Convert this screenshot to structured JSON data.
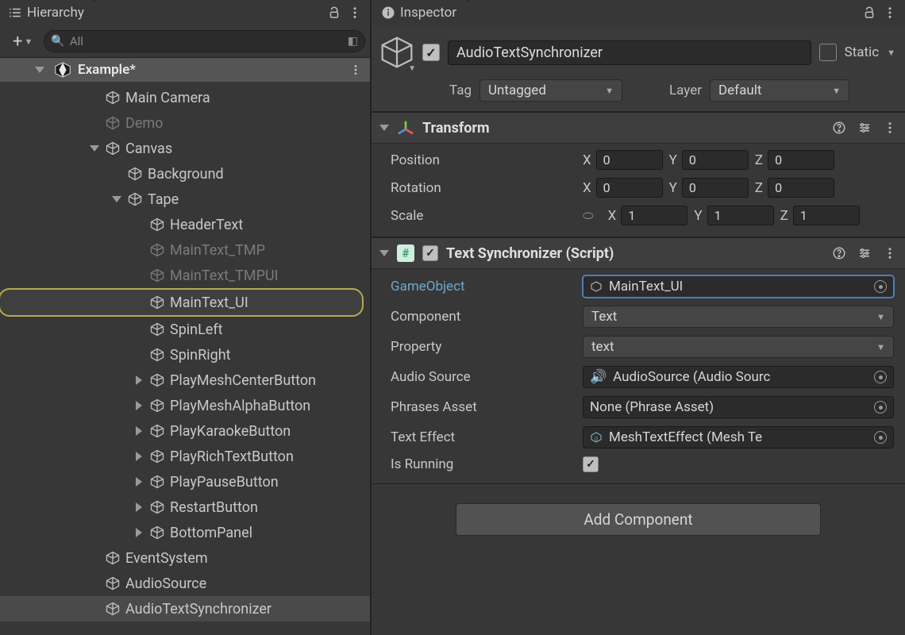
{
  "hierarchy": {
    "title": "Hierarchy",
    "search_placeholder": "All",
    "scene": "Example*",
    "items": [
      {
        "name": "Main Camera",
        "depth": 1,
        "dim": false
      },
      {
        "name": "Demo",
        "depth": 1,
        "dim": true
      },
      {
        "name": "Canvas",
        "depth": 1,
        "dim": false,
        "fold": "down"
      },
      {
        "name": "Background",
        "depth": 2,
        "dim": false
      },
      {
        "name": "Tape",
        "depth": 2,
        "dim": false,
        "fold": "down"
      },
      {
        "name": "HeaderText",
        "depth": 3,
        "dim": false
      },
      {
        "name": "MainText_TMP",
        "depth": 3,
        "dim": true
      },
      {
        "name": "MainText_TMPUI",
        "depth": 3,
        "dim": true
      },
      {
        "name": "MainText_UI",
        "depth": 3,
        "dim": false,
        "highlighted": true
      },
      {
        "name": "SpinLeft",
        "depth": 3,
        "dim": false
      },
      {
        "name": "SpinRight",
        "depth": 3,
        "dim": false
      },
      {
        "name": "PlayMeshCenterButton",
        "depth": 3,
        "dim": false,
        "fold": "right"
      },
      {
        "name": "PlayMeshAlphaButton",
        "depth": 3,
        "dim": false,
        "fold": "right"
      },
      {
        "name": "PlayKaraokeButton",
        "depth": 3,
        "dim": false,
        "fold": "right"
      },
      {
        "name": "PlayRichTextButton",
        "depth": 3,
        "dim": false,
        "fold": "right"
      },
      {
        "name": "PlayPauseButton",
        "depth": 3,
        "dim": false,
        "fold": "right"
      },
      {
        "name": "RestartButton",
        "depth": 3,
        "dim": false,
        "fold": "right"
      },
      {
        "name": "BottomPanel",
        "depth": 3,
        "dim": false,
        "fold": "right"
      },
      {
        "name": "EventSystem",
        "depth": 1,
        "dim": false
      },
      {
        "name": "AudioSource",
        "depth": 1,
        "dim": false
      },
      {
        "name": "AudioTextSynchronizer",
        "depth": 1,
        "dim": false,
        "selected": true
      }
    ]
  },
  "inspector": {
    "title": "Inspector",
    "enabled": true,
    "name": "AudioTextSynchronizer",
    "static_label": "Static",
    "tag_label": "Tag",
    "tag_value": "Untagged",
    "layer_label": "Layer",
    "layer_value": "Default",
    "transform": {
      "title": "Transform",
      "position_label": "Position",
      "rotation_label": "Rotation",
      "scale_label": "Scale",
      "position": {
        "x": "0",
        "y": "0",
        "z": "0"
      },
      "rotation": {
        "x": "0",
        "y": "0",
        "z": "0"
      },
      "scale": {
        "x": "1",
        "y": "1",
        "z": "1"
      }
    },
    "script": {
      "title": "Text Synchronizer (Script)",
      "fields": {
        "gameobject_label": "GameObject",
        "gameobject_value": "MainText_UI",
        "component_label": "Component",
        "component_value": "Text",
        "property_label": "Property",
        "property_value": "text",
        "audiosrc_label": "Audio Source",
        "audiosrc_value": "AudioSource (Audio Sourc",
        "phrases_label": "Phrases Asset",
        "phrases_value": "None (Phrase Asset)",
        "texteffect_label": "Text Effect",
        "texteffect_value": "MeshTextEffect (Mesh Te",
        "isrunning_label": "Is Running",
        "isrunning": true
      }
    },
    "add_component": "Add Component"
  }
}
